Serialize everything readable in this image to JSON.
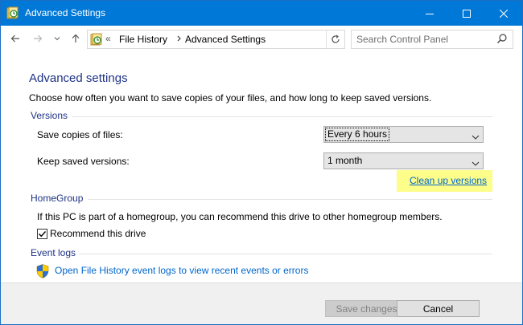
{
  "window": {
    "title": "Advanced Settings",
    "title_bar_color": "#0078d7"
  },
  "addressbar": {
    "overflow_chevron": "«",
    "breadcrumb": [
      "File History",
      "Advanced Settings"
    ],
    "search_placeholder": "Search Control Panel"
  },
  "main": {
    "heading": "Advanced settings",
    "intro": "Choose how often you want to save copies of your files, and how long to keep saved versions.",
    "versions": {
      "title": "Versions",
      "save_copies_label": "Save copies of files:",
      "save_copies_value": "Every 6 hours",
      "keep_versions_label": "Keep saved versions:",
      "keep_versions_value": "1 month",
      "cleanup_link": "Clean up versions"
    },
    "homegroup": {
      "title": "HomeGroup",
      "text": "If this PC is part of a homegroup, you can recommend this drive to other homegroup members.",
      "recommend_label": "Recommend this drive",
      "recommend_checked": true
    },
    "event_logs": {
      "title": "Event logs",
      "link": "Open File History event logs to view recent events or errors"
    }
  },
  "footer": {
    "save_label": "Save changes",
    "cancel_label": "Cancel"
  },
  "colors": {
    "heading": "#1e3287",
    "link": "#0066cc",
    "highlight": "#fdfd8a"
  }
}
